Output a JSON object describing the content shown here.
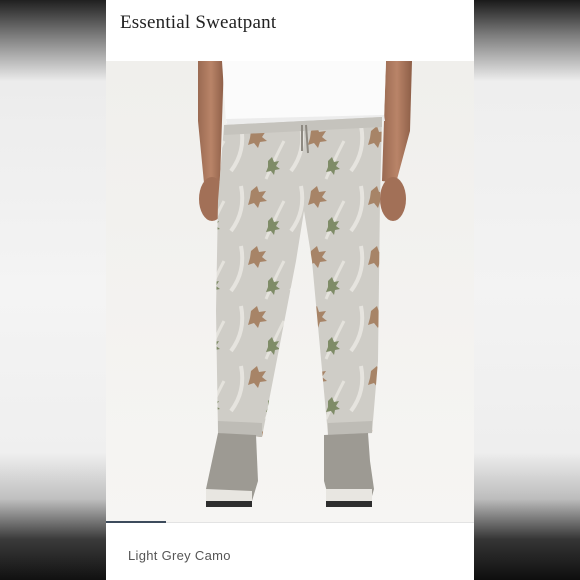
{
  "product": {
    "title": "Essential Sweatpant",
    "color_name": "Light Grey Camo",
    "image_alt": "model wearing light grey camo sweatpants with leaf pattern and grey sneakers"
  },
  "carousel": {
    "active_index": 0
  },
  "colors": {
    "card_bg": "#ffffff",
    "photo_bg": "#f2f1ee",
    "indicator": "#3d4b5c",
    "pant_base": "#cfcdc7"
  }
}
